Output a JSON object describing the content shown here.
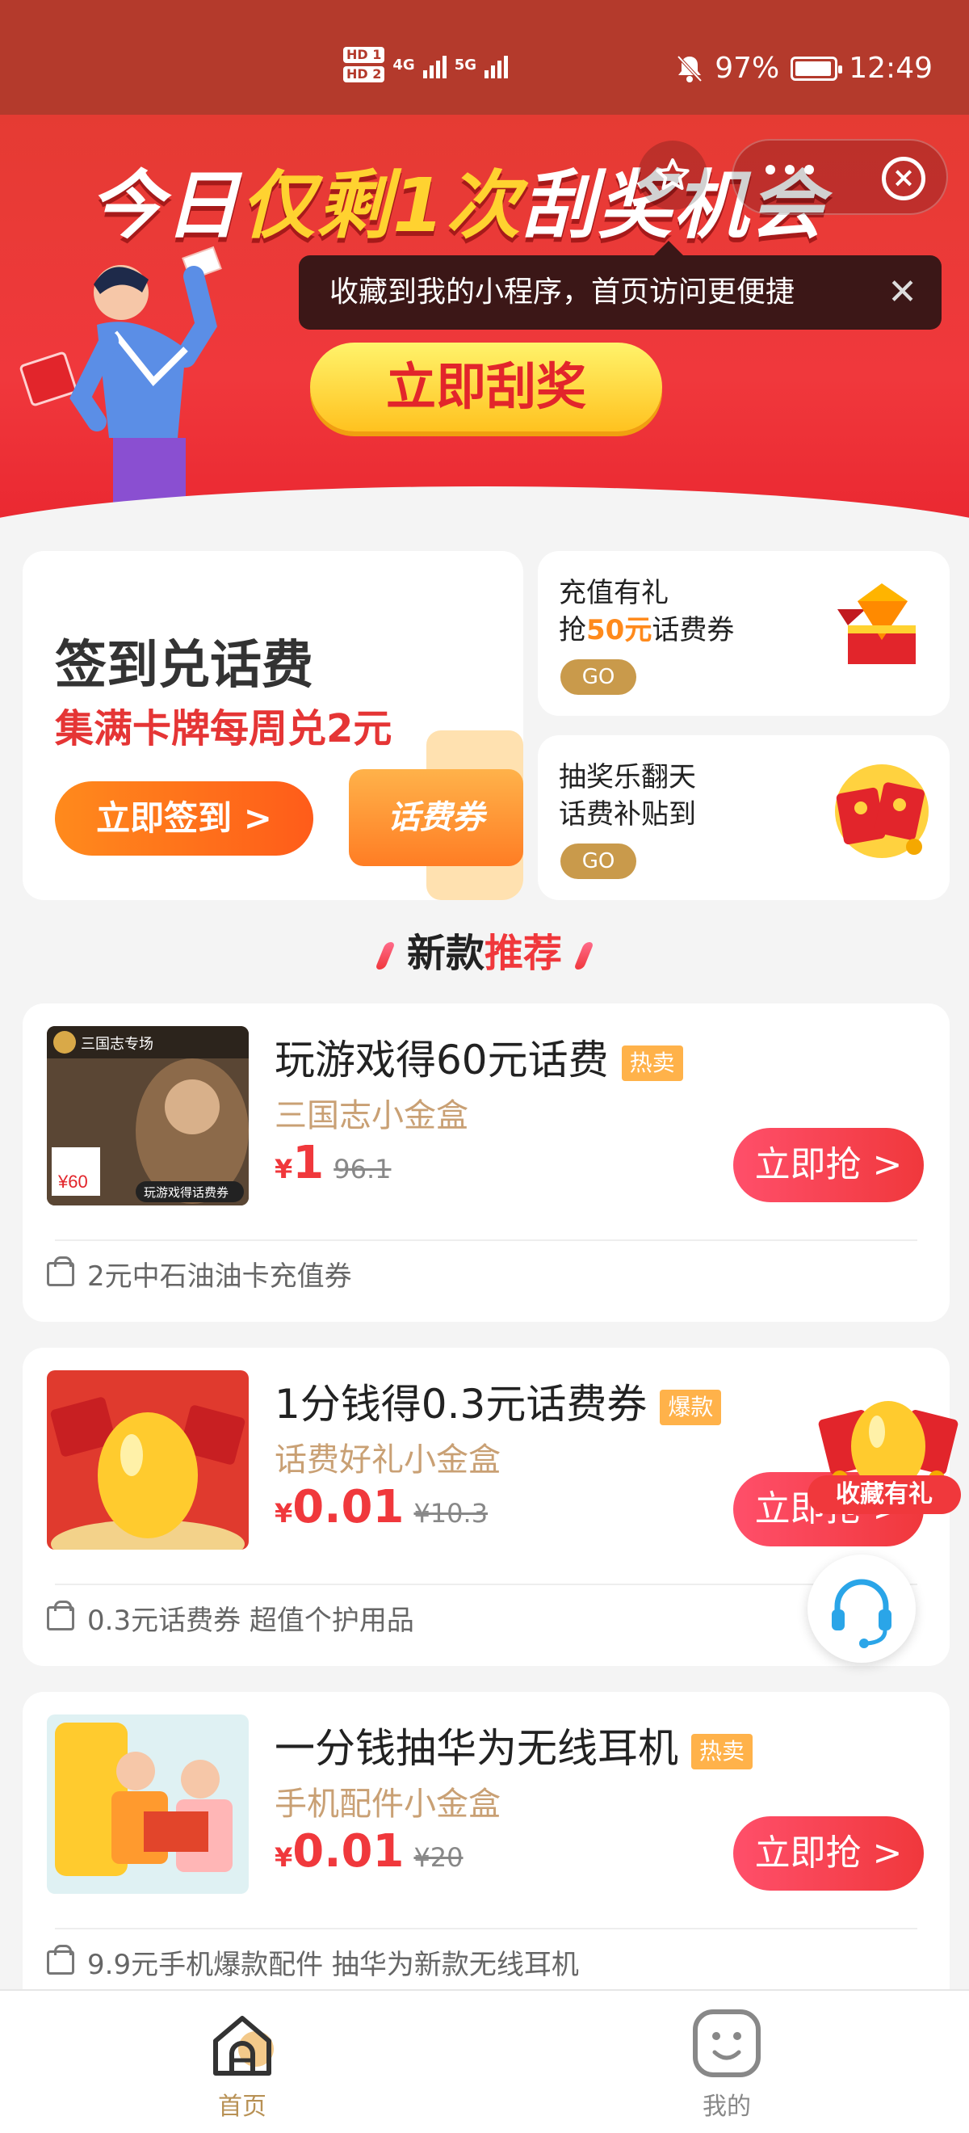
{
  "status_bar": {
    "hd_badges": [
      "HD 1",
      "HD 2"
    ],
    "network": [
      "4G",
      "5G"
    ],
    "battery": "97%",
    "time": "12:49"
  },
  "hero": {
    "title_part1": "今日",
    "title_part2": "仅剩1次",
    "title_part3": "刮奖机会",
    "button": "立即刮奖"
  },
  "tooltip": {
    "text": "收藏到我的小程序，首页访问更便捷",
    "close": "✕"
  },
  "signin_card": {
    "title": "签到兑话费",
    "subtitle": "集满卡牌每周兑2元",
    "button": "立即签到 >",
    "coupon_label": "话费券"
  },
  "recharge_card": {
    "line1": "充值有礼",
    "line2_prefix": "抢",
    "line2_highlight": "50元",
    "line2_suffix": "话费券",
    "go": "GO"
  },
  "lottery_card": {
    "line1": "抽奖乐翻天",
    "line2": "话费补贴到",
    "go": "GO"
  },
  "section": {
    "title_black": "新款",
    "title_red": "推荐"
  },
  "products": [
    {
      "name": "玩游戏得60元话费",
      "tag": "热卖",
      "sub": "三国志小金盒",
      "symbol": "¥",
      "price": "1",
      "old_price": "96.1",
      "buy": "立即抢 >",
      "foot": "2元中石油油卡充值券",
      "thumb_label": "三国志专场",
      "thumb_bottom": "玩游戏得话费券"
    },
    {
      "name": "1分钱得0.3元话费券",
      "tag": "爆款",
      "sub": "话费好礼小金盒",
      "symbol": "¥",
      "price": "0.01",
      "old_price": "¥10.3",
      "buy": "立即抢 >",
      "foot": "0.3元话费券 超值个护用品"
    },
    {
      "name": "一分钱抽华为无线耳机",
      "tag": "热卖",
      "sub": "手机配件小金盒",
      "symbol": "¥",
      "price": "0.01",
      "old_price": "¥20",
      "buy": "立即抢 >",
      "foot": "9.9元手机爆款配件 抽华为新款无线耳机"
    }
  ],
  "floating": {
    "gift_label": "收藏有礼"
  },
  "bottom_nav": {
    "home": "首页",
    "mine": "我的"
  },
  "colors": {
    "status_bar": "#b43a2c",
    "accent_red": "#f0383c",
    "gold": "#c99a4b"
  }
}
